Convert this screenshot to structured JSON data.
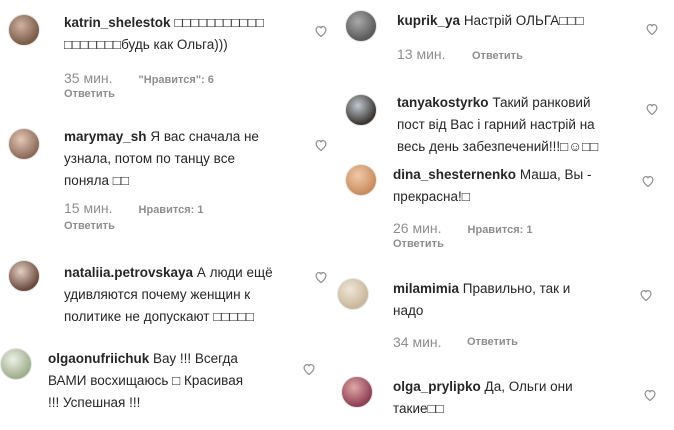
{
  "comments_left": [
    {
      "username": "katrin_shelestok",
      "lines": [
        "□□□□□□□□□□□",
        "□□□□□□□будь как Ольга)))"
      ],
      "time": "35 мин.",
      "likes": "\"Нравится\": 6",
      "reply": "Ответить",
      "avatar": [
        "#d0b2a0",
        "#7a5a48"
      ]
    },
    {
      "username": "marymay_sh",
      "lines": [
        "Я вас сначала не",
        "узнала, потом по танцу все",
        "поняла □□"
      ],
      "time": "15 мин.",
      "likes": "Нравится: 1",
      "reply": "Ответить",
      "avatar": [
        "#e4c7b4",
        "#8b6a5a"
      ]
    },
    {
      "username": "nataliia.petrovskaya",
      "lines": [
        "А люди ещё",
        "удивляются почему женщин к",
        "политике не допускают □□□□□"
      ],
      "time": "",
      "likes": "",
      "reply": "",
      "avatar": [
        "#e3cfc2",
        "#6a4b3d"
      ]
    },
    {
      "username": "olgaonufriichuk",
      "lines": [
        "Вау !!! Всегда",
        "ВАМИ восхищаюсь □ Красивая",
        "!!! Успешная !!!"
      ],
      "time": "",
      "likes": "",
      "reply": "",
      "avatar": [
        "#eef0e8",
        "#9fae8c"
      ]
    }
  ],
  "comments_right": [
    {
      "username": "kuprik_ya",
      "lines": [
        "Настрій ОЛЬГА□□□"
      ],
      "time": "13 мин.",
      "likes": "",
      "reply": "Ответить",
      "avatar": [
        "#a9a9a9",
        "#5a5a5a"
      ]
    },
    {
      "username": "tanyakostyrko",
      "lines": [
        "Такий ранковий",
        "пост від Вас і гарний настрій на",
        "весь день забезпечений!!!□☺□□"
      ],
      "time": "",
      "likes": "",
      "reply": "",
      "avatar": [
        "#c1c8cf",
        "#3a3632"
      ]
    },
    {
      "username": "dina_shesternenko",
      "lines": [
        "Маша, Вы -",
        "прекрасна!□"
      ],
      "time": "26 мин.",
      "likes": "Нравится: 1",
      "reply": "Ответить",
      "avatar": [
        "#f0c9a8",
        "#c98d5e"
      ]
    },
    {
      "username": "milamimia",
      "lines": [
        "Правильно, так и",
        "надо"
      ],
      "time": "34 мин.",
      "likes": "",
      "reply": "Ответить",
      "avatar": [
        "#efe6d8",
        "#c8b79a"
      ]
    },
    {
      "username": "olga_prylipko",
      "lines": [
        "Да, Ольги они",
        "такие□□"
      ],
      "time": "",
      "likes": "",
      "reply": "",
      "avatar": [
        "#e0a7a7",
        "#8e3f55"
      ]
    }
  ],
  "icons": {
    "like": "heart-outline-icon"
  },
  "colors": {
    "text": "#262626",
    "muted": "#8e8e8e",
    "heart": "#8e8e8e"
  }
}
